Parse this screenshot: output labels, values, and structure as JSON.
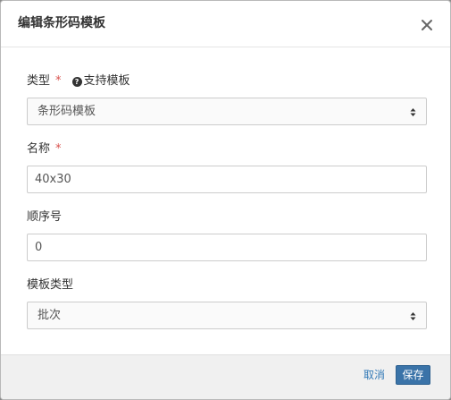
{
  "dialog": {
    "title": "编辑条形码模板",
    "close_icon": "close-icon"
  },
  "form": {
    "type": {
      "label": "类型",
      "required_mark": "*",
      "help_icon_glyph": "?",
      "help_text": "支持模板",
      "value": "条形码模板"
    },
    "name": {
      "label": "名称",
      "required_mark": "*",
      "value": "40x30"
    },
    "order": {
      "label": "顺序号",
      "value": "0"
    },
    "template_type": {
      "label": "模板类型",
      "value": "批次"
    }
  },
  "footer": {
    "cancel_label": "取消",
    "save_label": "保存"
  },
  "colors": {
    "primary": "#3a73a8",
    "link": "#337ab7",
    "required": "#d9534f"
  }
}
